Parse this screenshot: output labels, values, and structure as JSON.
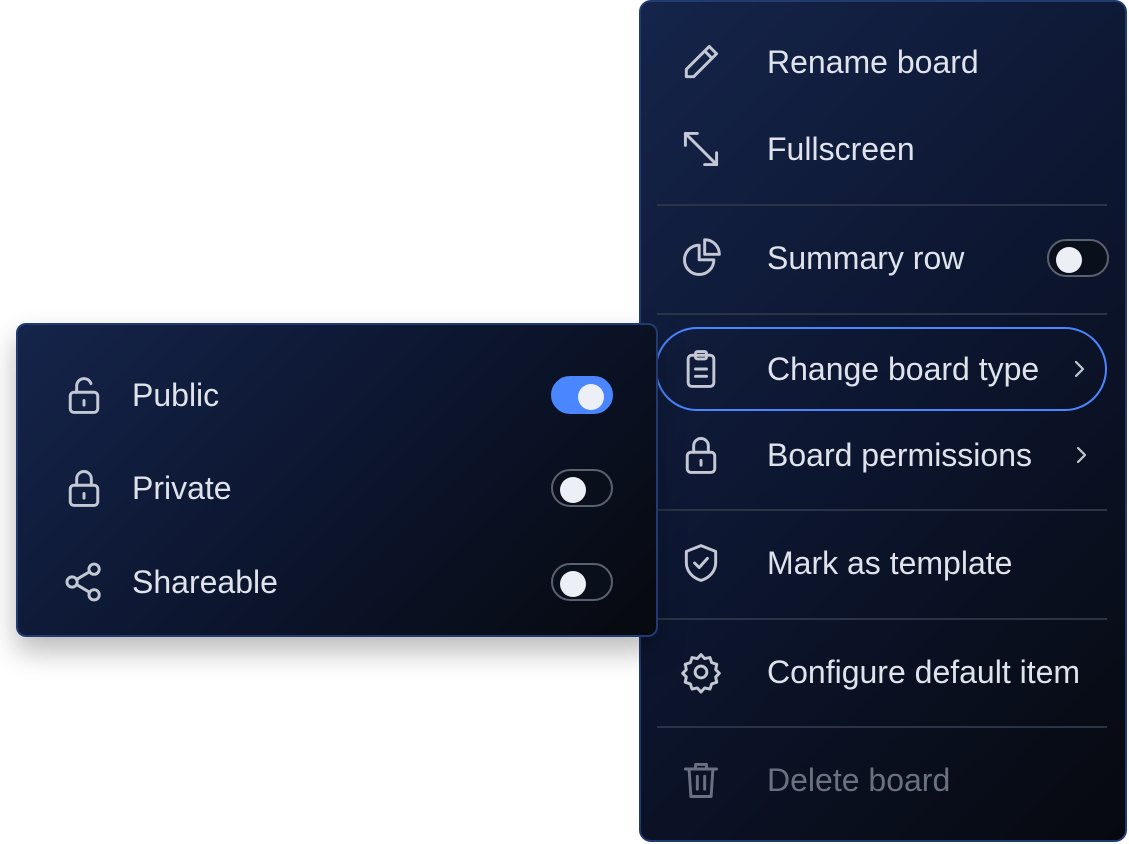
{
  "board_menu": {
    "items": [
      {
        "label": "Rename board",
        "icon": "pencil-icon"
      },
      {
        "label": "Fullscreen",
        "icon": "expand-arrows-icon"
      },
      {
        "label": "Summary row",
        "icon": "pie-chart-icon",
        "toggle": false
      },
      {
        "label": "Change board type",
        "icon": "clipboard-icon",
        "has_submenu": true,
        "active": true
      },
      {
        "label": "Board permissions",
        "icon": "lock-icon",
        "has_submenu": true
      },
      {
        "label": "Mark as template",
        "icon": "shield-check-icon"
      },
      {
        "label": "Configure default item",
        "icon": "gear-icon"
      },
      {
        "label": "Delete board",
        "icon": "trash-icon",
        "disabled": true
      }
    ]
  },
  "board_type_submenu": {
    "items": [
      {
        "label": "Public",
        "icon": "unlocked-padlock-icon",
        "enabled": true
      },
      {
        "label": "Private",
        "icon": "padlock-icon",
        "enabled": false
      },
      {
        "label": "Shareable",
        "icon": "share-icon",
        "enabled": false
      }
    ]
  },
  "colors": {
    "accent": "#4a86ff",
    "menu_background": "#0d1732",
    "menu_border": "#213a70",
    "text": "#dfe3ec",
    "disabled_text": "#6b7180"
  }
}
